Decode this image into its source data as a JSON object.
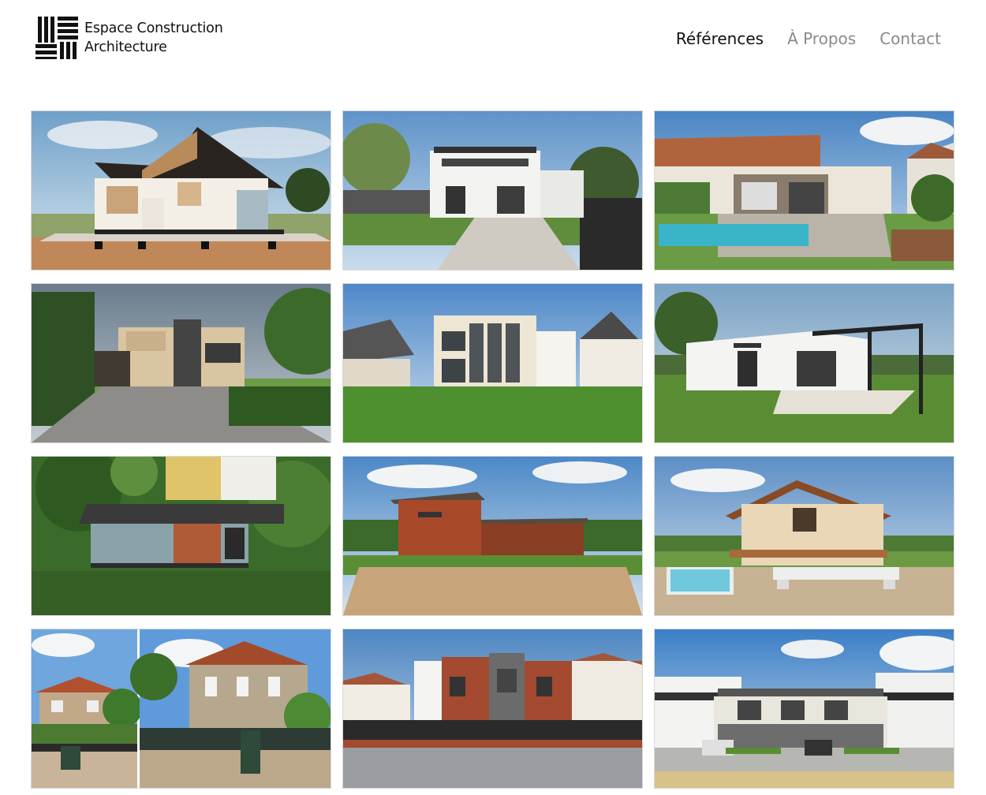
{
  "brand": {
    "name_line1": "Espace Construction",
    "name_line2": "Architecture",
    "logo_icon": "parquet-pattern-logo"
  },
  "nav": {
    "items": [
      {
        "label": "Références",
        "active": true
      },
      {
        "label": "À Propos",
        "active": false
      },
      {
        "label": "Contact",
        "active": false
      }
    ],
    "active_color": "#111111",
    "inactive_color": "#8a8a8a"
  },
  "gallery": {
    "columns": 3,
    "rows": 4,
    "items": [
      "section-cut-house-render",
      "white-modern-villa-render",
      "pool-extension-render",
      "two-story-driveway-render",
      "tall-window-villa-render",
      "white-pergola-extension-render",
      "tree-house-render",
      "wood-clad-house-render",
      "wood-house-section-pool-render",
      "stone-facade-photo-pair",
      "brick-townhouses-render",
      "residential-complex-render"
    ]
  }
}
